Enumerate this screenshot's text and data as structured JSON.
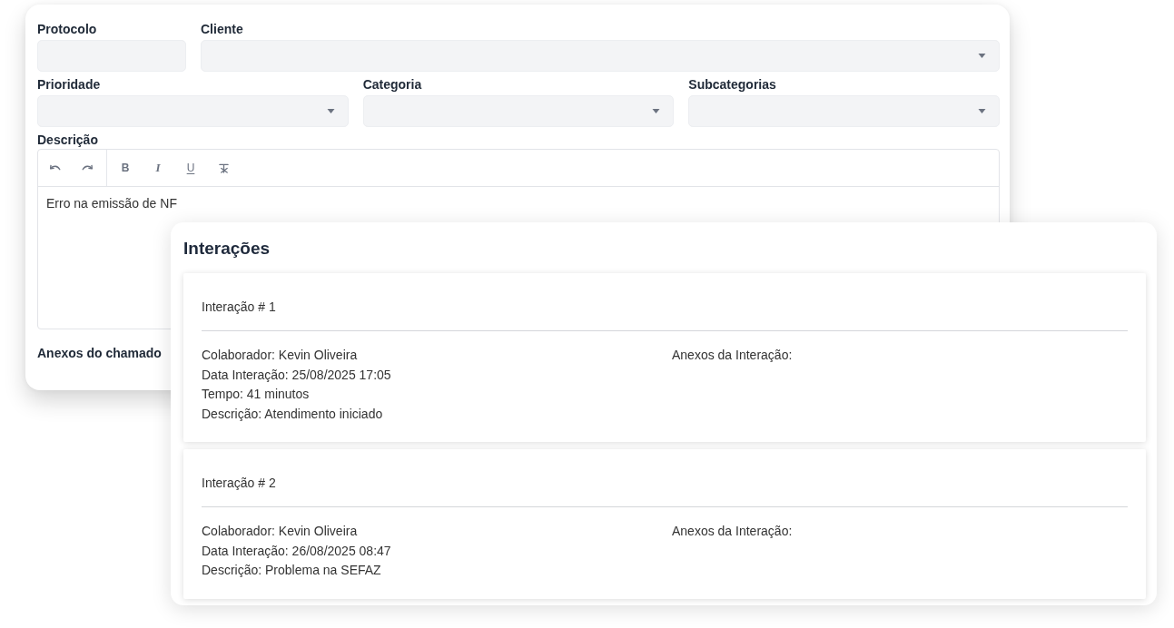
{
  "form": {
    "rows": [
      {
        "fields": [
          {
            "label": "Protocolo",
            "kind": "text"
          },
          {
            "label": "Cliente",
            "kind": "select"
          }
        ]
      },
      {
        "fields": [
          {
            "label": "Prioridade",
            "kind": "select"
          },
          {
            "label": "Categoria",
            "kind": "select"
          },
          {
            "label": "Subcategorias",
            "kind": "select"
          }
        ]
      }
    ],
    "description": {
      "label": "Descrição",
      "toolbar": [
        {
          "buttons": [
            {
              "kind": "undo"
            },
            {
              "kind": "redo"
            }
          ]
        },
        {
          "buttons": [
            {
              "kind": "bold",
              "text": "B"
            },
            {
              "kind": "italic",
              "text": "I"
            },
            {
              "kind": "underline",
              "text": "U"
            },
            {
              "kind": "clear"
            }
          ]
        }
      ],
      "value": "Erro na emissão de NF"
    },
    "attachments_label": "Anexos do chamado"
  },
  "interactions": {
    "title": "Interações",
    "items": [
      {
        "title": "Interação # 1",
        "details": [
          "Colaborador: Kevin Oliveira",
          "Data Interação: 25/08/2025 17:05",
          "Tempo: 41 minutos",
          "Descrição: Atendimento iniciado"
        ],
        "attachments_label": "Anexos da Interação:"
      },
      {
        "title": "Interação # 2",
        "details": [
          "Colaborador: Kevin Oliveira",
          "Data Interação: 26/08/2025 08:47",
          "Descrição: Problema na SEFAZ"
        ],
        "attachments_label": "Anexos da Interação:"
      }
    ]
  }
}
